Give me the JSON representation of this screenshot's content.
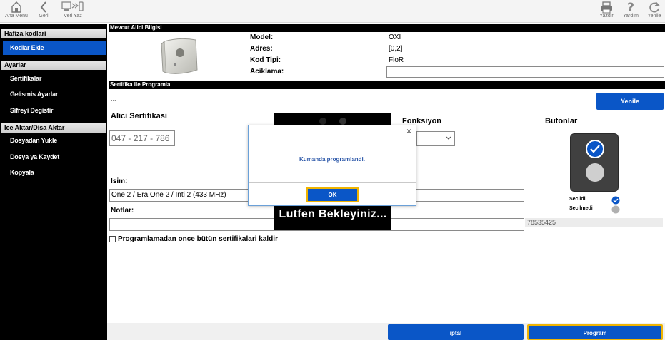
{
  "toolbar": {
    "home_label": "Ana Menu",
    "back_label": "Geri",
    "write_label": "Veri Yaz",
    "print_label": "Yazdir",
    "help_label": "Yardım",
    "refresh_label": "Yenile"
  },
  "sidebar": {
    "group1_title": "Hafiza kodlari",
    "group1_items": [
      "Kodlar Ekle"
    ],
    "group2_title": "Ayarlar",
    "group2_items": [
      "Sertifikalar",
      "Gelismis Ayarlar",
      "Sifreyi Degistir"
    ],
    "group3_title": "Ice Aktar/Disa Aktar",
    "group3_items": [
      "Dosyadan Yukle",
      "Dosya ya Kaydet",
      "Kopyala"
    ]
  },
  "receiver": {
    "section_title": "Mevcut Alici Bilgisi",
    "model_label": "Model:",
    "model_value": "OXI",
    "address_label": "Adres:",
    "address_value": "[0,2]",
    "code_type_label": "Kod Tipi:",
    "code_type_value": "FloR",
    "description_label": "Aciklama:",
    "description_value": ""
  },
  "programming": {
    "section_title": "Sertifika ile Programla",
    "dots": "...",
    "refresh_button": "Yenile",
    "cert_label": "Alici Sertifikasi",
    "cert_part1": "047",
    "cert_sep1": "-",
    "cert_part2": "217",
    "cert_sep2": "-",
    "cert_part3": "786",
    "function_label": "Fonksiyon",
    "buttons_label": "Butonlar",
    "name_label": "Isim:",
    "name_value": "One 2 / Era One 2 / Inti 2 (433 MHz)",
    "notes_label": "Notlar:",
    "notes_value": "",
    "serial_value": "78535425",
    "remove_certs_label": "Programlamadan once bütün sertifikalari kaldir",
    "selected_label": "Secildi",
    "not_selected_label": "Secilmedi"
  },
  "busy": {
    "text": "Lutfen Bekleyiniz..."
  },
  "dialog": {
    "message": "Kumanda programlandi.",
    "ok_label": "OK",
    "close_glyph": "×"
  },
  "footer": {
    "cancel_label": "iptal",
    "program_label": "Program"
  },
  "colors": {
    "accent": "#0a56c7",
    "focus_border": "#f0b400",
    "selected": "#0a56c7",
    "not_selected": "#b0b0b0"
  }
}
